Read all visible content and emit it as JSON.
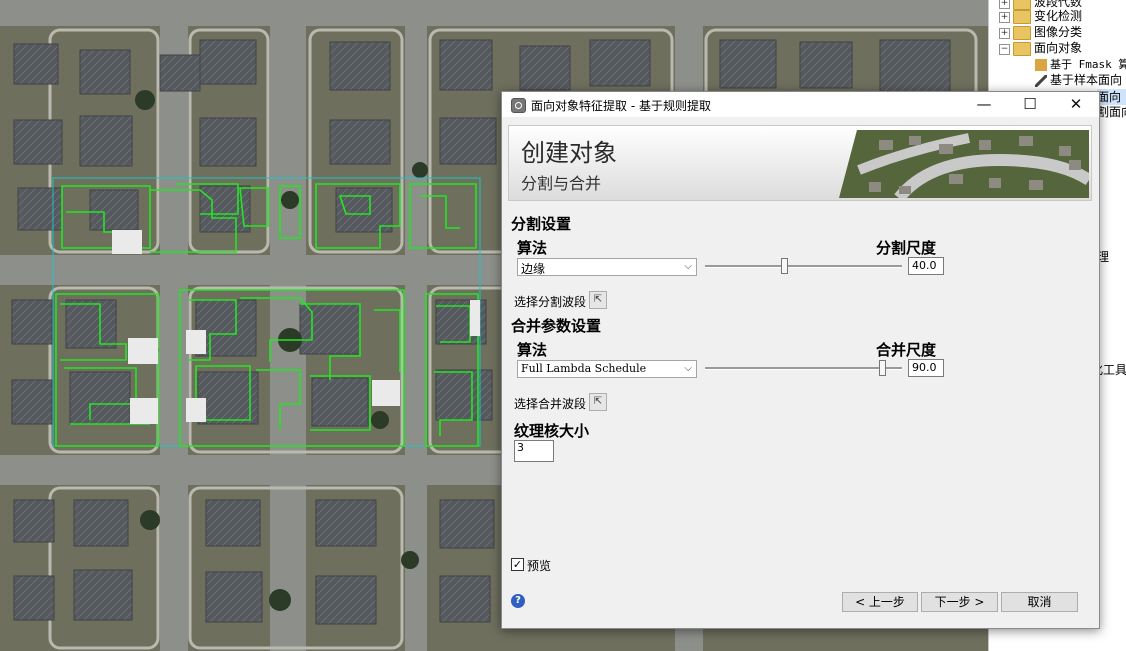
{
  "tree": {
    "items": [
      {
        "label": "波段代数"
      },
      {
        "label": "变化检测"
      },
      {
        "label": "图像分类"
      },
      {
        "label": "面向对象"
      },
      {
        "label": "基于 Fmask 算"
      },
      {
        "label": "基于样本面向"
      },
      {
        "label": "面向"
      },
      {
        "label": "割面向"
      }
    ],
    "side_text_1": "理",
    "side_text_2": "化工具"
  },
  "dialog": {
    "title": "面向对象特征提取 - 基于规则提取",
    "window_buttons": {
      "minimize": "—",
      "maximize": "☐",
      "close": "✕"
    },
    "banner": {
      "title": "创建对象",
      "subtitle": "分割与合并"
    },
    "segment": {
      "section": "分割设置",
      "algo_label": "算法",
      "scale_label": "分割尺度",
      "algorithm": "边缘",
      "scale_value": "40.0",
      "scale_fraction": 0.4,
      "band_label": "选择分割波段"
    },
    "merge": {
      "section": "合并参数设置",
      "algo_label": "算法",
      "scale_label": "合并尺度",
      "algorithm": "Full Lambda Schedule",
      "scale_value": "90.0",
      "scale_fraction": 0.9,
      "band_label": "选择合并波段"
    },
    "texture": {
      "label": "纹理核大小",
      "value": "3"
    },
    "preview": {
      "label": "预览",
      "checked": true,
      "check_glyph": "✓"
    },
    "buttons": {
      "help": "?",
      "prev": "< 上一步",
      "next": "下一步 >",
      "cancel": "取消"
    }
  },
  "colors": {
    "segment_outline": "#22e622",
    "preview_box": "#19c4c4",
    "accent": "#2f5fbf"
  }
}
